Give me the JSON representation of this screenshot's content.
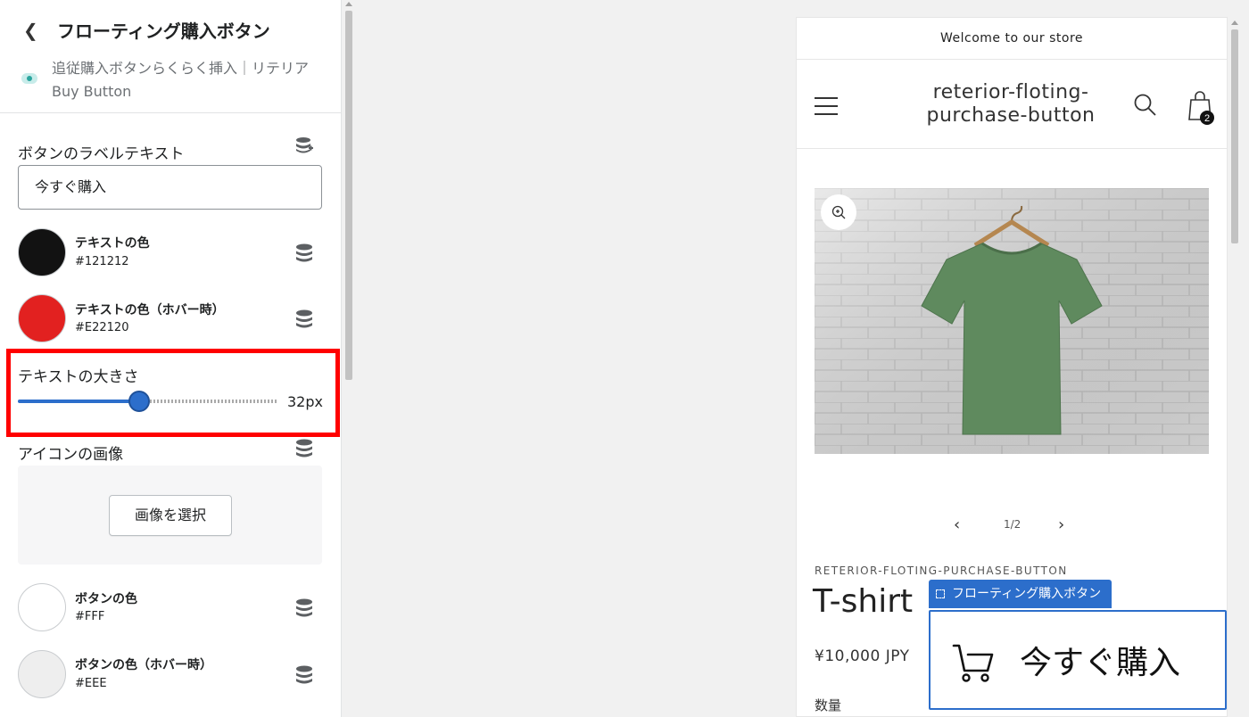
{
  "settings_panel": {
    "title": "フローティング購入ボタン",
    "app_name": "追従購入ボタンらくらく挿入｜リテリア Buy Button",
    "label_text": {
      "label": "ボタンのラベルテキスト",
      "value": "今すぐ購入"
    },
    "text_color": {
      "name": "テキストの色",
      "value": "#121212",
      "swatch": "#121212"
    },
    "text_color_hover": {
      "name": "テキストの色（ホバー時）",
      "value": "#E22120",
      "swatch": "#E22120"
    },
    "text_size": {
      "label": "テキストの大きさ",
      "value_label": "32px",
      "fraction": 0.47
    },
    "icon_image": {
      "label": "アイコンの画像",
      "select_button": "画像を選択"
    },
    "button_color": {
      "name": "ボタンの色",
      "value": "#FFF",
      "swatch": "#FFFFFF"
    },
    "button_color_hover": {
      "name": "ボタンの色（ホバー時）",
      "value": "#EEE",
      "swatch": "#EEEEEE"
    }
  },
  "preview": {
    "announcement": "Welcome to our store",
    "shop_name": "reterior-floting-purchase-button",
    "cart_count": "2",
    "gallery_pager": "1/2",
    "vendor": "RETERIOR-FLOTING-PURCHASE-BUTTON",
    "product_title": "T-shirt",
    "price": "¥10,000 JPY",
    "quantity_label": "数量",
    "section_tag": "フローティング購入ボタン",
    "floating_button_label": "今すぐ購入"
  },
  "colors": {
    "accent": "#2c6ecb",
    "highlight_box": "#ff0000",
    "shirt": "#5f8a5e"
  }
}
